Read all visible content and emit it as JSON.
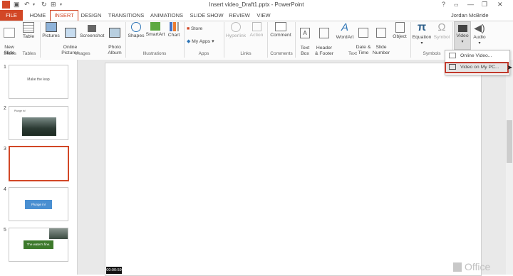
{
  "app_title": "Insert video_Draft1.pptx - PowerPoint",
  "window_controls": {
    "help": "?",
    "minimize": "—",
    "restore": "❐",
    "close": "✕"
  },
  "tabs": [
    "FILE",
    "HOME",
    "INSERT",
    "DESIGN",
    "TRANSITIONS",
    "ANIMATIONS",
    "SLIDE SHOW",
    "REVIEW",
    "VIEW"
  ],
  "user_name": "Jordan McBride",
  "ribbon": {
    "new_slide": "New\nSlide",
    "table": "Table",
    "pictures": "Pictures",
    "online_pictures": "Online\nPictures",
    "screenshot": "Screenshot",
    "photo_album": "Photo\nAlbum",
    "shapes": "Shapes",
    "smartart": "SmartArt",
    "chart": "Chart",
    "store": "Store",
    "my_apps": "My Apps",
    "hyperlink": "Hyperlink",
    "action": "Action",
    "comment": "Comment",
    "text_box": "Text\nBox",
    "header_footer": "Header\n& Footer",
    "wordart": "WordArt",
    "date_time": "Date &\nTime",
    "slide_number": "Slide\nNumber",
    "object": "Object",
    "equation": "Equation",
    "symbol": "Symbol",
    "video": "Video",
    "audio": "Audio",
    "groups": {
      "slides": "Slides",
      "tables": "Tables",
      "images": "Images",
      "illustrations": "Illustrations",
      "apps": "Apps",
      "links": "Links",
      "comments": "Comments",
      "text": "Text",
      "symbols": "Symbols"
    }
  },
  "video_menu": [
    "Online Video...",
    "Video on My PC..."
  ],
  "slides": [
    {
      "num": "1",
      "text": "Make the leap"
    },
    {
      "num": "2",
      "text": "Plunge in!"
    },
    {
      "num": "3",
      "text": ""
    },
    {
      "num": "4",
      "text": "Plunge in!"
    },
    {
      "num": "5",
      "text": "The water's fine."
    }
  ],
  "timecode": "00:00:59",
  "office_logo_text": "Office",
  "colors": {
    "accent": "#d24726",
    "highlight_box": "#c0392b",
    "button_blue": "#4a8fd1",
    "button_green": "#3d7a2c"
  }
}
